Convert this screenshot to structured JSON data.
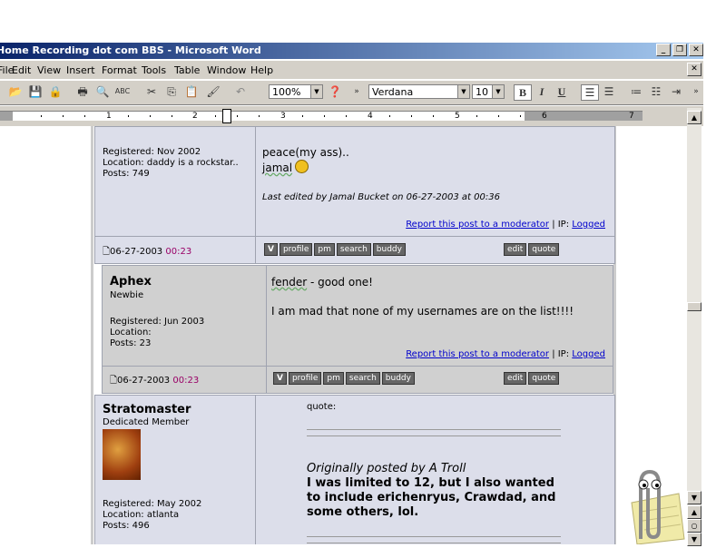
{
  "window": {
    "title": "Home Recording dot com BBS - Microsoft Word"
  },
  "menu": [
    "File",
    "Edit",
    "View",
    "Insert",
    "Format",
    "Tools",
    "Table",
    "Window",
    "Help"
  ],
  "toolbar": {
    "zoom": "100%",
    "font": "Verdana",
    "size": "10",
    "bold": "B",
    "italic": "I",
    "underline": "U"
  },
  "ruler": {
    "numbers": [
      "1",
      "2",
      "3",
      "4",
      "5",
      "6",
      "7"
    ]
  },
  "posts": [
    {
      "registered": "Registered: Nov 2002",
      "location": "Location: daddy is a rockstar..",
      "posts": "Posts: 749",
      "line1": "peace(my ass)..",
      "line2": "jamal",
      "edited": "Last edited by Jamal Bucket on 06-27-2003 at 00:36",
      "report": "Report this post to a moderator",
      "ip_label": "| IP:",
      "logged": "Logged",
      "date": "06-27-2003",
      "time": "00:23"
    },
    {
      "name": "Aphex",
      "rank": "Newbie",
      "registered": "Registered: Jun 2003",
      "location": "Location:",
      "posts": "Posts: 23",
      "line1a": "fender",
      "line1b": " - good one!",
      "line2": "I am mad that none of my usernames are on the list!!!!",
      "report": "Report this post to a moderator",
      "ip_label": "| IP:",
      "logged": "Logged",
      "date": "06-27-2003",
      "time": "00:23"
    },
    {
      "name": "Stratomaster",
      "rank": "Dedicated Member",
      "registered": "Registered: May 2002",
      "location": "Location: atlanta",
      "posts": "Posts: 496",
      "quote_label": "quote:",
      "orig": "Originally posted by A Troll",
      "quote_text": "I was limited to 12, but I also wanted to include erichenryus, Crawdad, and some others, lol."
    }
  ],
  "post_buttons": [
    "profile",
    "pm",
    "search",
    "buddy",
    "edit",
    "quote"
  ],
  "colors": {
    "post_bg_light": "#dcdeea",
    "post_bg_gray": "#d0d0d0",
    "time": "#990066",
    "title_bar": "#0a246a"
  }
}
